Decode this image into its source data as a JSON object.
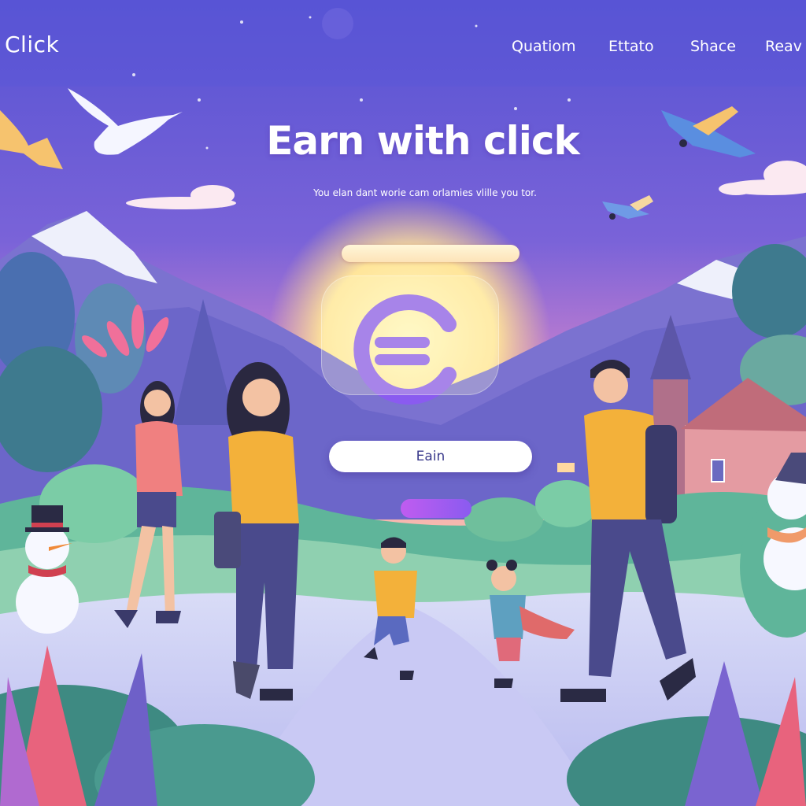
{
  "header": {
    "brand": "Click",
    "nav": [
      "Quatiom",
      "Ettato",
      "Shace",
      "Reav"
    ]
  },
  "hero": {
    "title": "Earn with click",
    "subtitle": "You elan dant worie cam orlamies vlille you tor.",
    "coin_symbol": "€",
    "earn_button": "Eain"
  },
  "colors": {
    "sky_top": "#5b55d6",
    "sky_bottom": "#f29cb8",
    "sun": "#fff1a8",
    "accent_purple": "#8a5bf0",
    "button_text": "#3a3a8c"
  },
  "icons": [
    "euro-coin-icon",
    "bird-icon",
    "airplane-icon",
    "snowman-icon",
    "house-icon"
  ]
}
